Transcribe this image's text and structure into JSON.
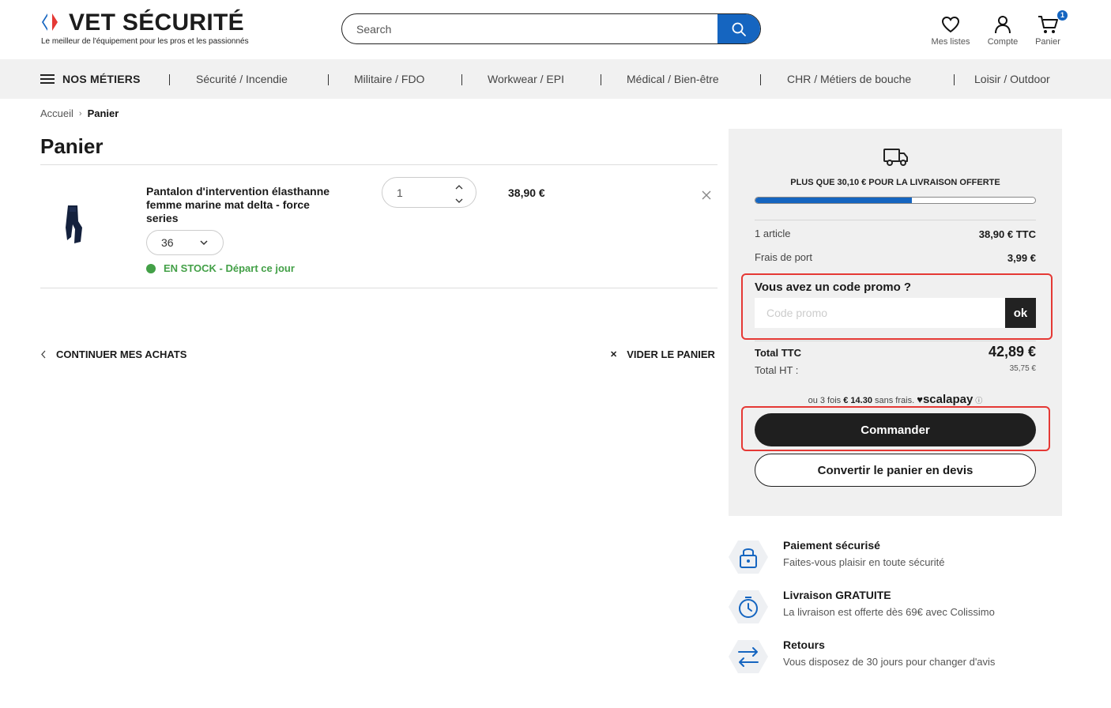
{
  "header": {
    "logo_text": "VET SÉCURITÉ",
    "logo_tagline": "Le meilleur de l'équipement pour les pros et les passionnés",
    "search_placeholder": "Search",
    "icons": {
      "wishlist_label": "Mes listes",
      "account_label": "Compte",
      "cart_label": "Panier",
      "cart_count": "1"
    }
  },
  "nav": {
    "metiers_label": "NOS MÉTIERS",
    "items": [
      "Sécurité / Incendie",
      "Militaire / FDO",
      "Workwear / EPI",
      "Médical / Bien-être",
      "CHR / Métiers de bouche",
      "Loisir / Outdoor"
    ]
  },
  "breadcrumb": {
    "home": "Accueil",
    "current": "Panier"
  },
  "page_title": "Panier",
  "cart_item": {
    "name": "Pantalon d'intervention élasthanne femme marine mat delta - force series",
    "size": "36",
    "stock": "EN STOCK - Départ ce jour",
    "quantity": "1",
    "price": "38,90 €"
  },
  "actions": {
    "continue": "CONTINUER MES ACHATS",
    "empty": "VIDER LE PANIER"
  },
  "summary": {
    "shipping_msg": "PLUS QUE 30,10 € POUR LA LIVRAISON OFFERTE",
    "shipping_progress_fraction": 0.56,
    "articles_label": "1 article",
    "articles_value": "38,90 € TTC",
    "shipping_label": "Frais de port",
    "shipping_value": "3,99 €",
    "promo_title": "Vous avez un code promo ?",
    "promo_placeholder": "Code promo",
    "promo_ok": "ok",
    "total_ttc_label": "Total TTC",
    "total_ttc_value": "42,89 €",
    "total_ht_label": "Total HT :",
    "total_ht_value": "35,75 €",
    "scalapay_prefix": "ou 3 fois",
    "scalapay_amount": "€ 14.30",
    "scalapay_suffix": "sans frais.",
    "scalapay_brand": "scalapay",
    "order_button": "Commander",
    "quote_button": "Convertir le panier en devis"
  },
  "reassurance": [
    {
      "title": "Paiement sécurisé",
      "desc": "Faites-vous plaisir en toute sécurité",
      "icon": "lock-icon"
    },
    {
      "title": "Livraison GRATUITE",
      "desc": "La livraison est offerte dès 69€ avec Colissimo",
      "icon": "stopwatch-icon"
    },
    {
      "title": "Retours",
      "desc": "Vous disposez de 30 jours pour changer d'avis",
      "icon": "exchange-arrows-icon"
    }
  ],
  "colors": {
    "accent": "#1565c0",
    "stock": "#43a047",
    "highlight": "#e53935",
    "dark_button": "#1f1f1f"
  }
}
